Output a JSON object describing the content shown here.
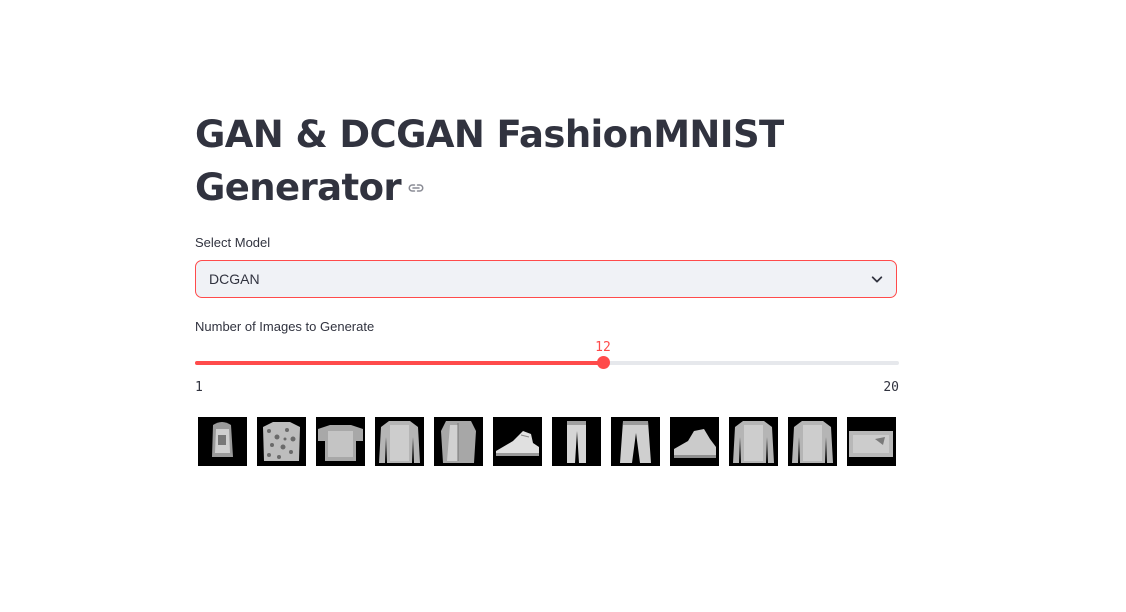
{
  "page": {
    "title_line1": "GAN & DCGAN FashionMNIST",
    "title_line2": "Generator",
    "link_icon": "link-icon"
  },
  "model_select": {
    "label": "Select Model",
    "value": "DCGAN",
    "icon": "chevron-down-icon"
  },
  "slider": {
    "label": "Number of Images to Generate",
    "value": "12",
    "min": "1",
    "max": "20",
    "accent_color": "#ff4b4b"
  },
  "gallery": {
    "images": [
      {
        "name": "generated-image",
        "kind": "bag"
      },
      {
        "name": "generated-image",
        "kind": "patterned-shirt"
      },
      {
        "name": "generated-image",
        "kind": "top"
      },
      {
        "name": "generated-image",
        "kind": "pullover"
      },
      {
        "name": "generated-image",
        "kind": "coat"
      },
      {
        "name": "generated-image",
        "kind": "sneaker"
      },
      {
        "name": "generated-image",
        "kind": "trouser"
      },
      {
        "name": "generated-image",
        "kind": "trouser-wide"
      },
      {
        "name": "generated-image",
        "kind": "ankle-boot"
      },
      {
        "name": "generated-image",
        "kind": "pullover"
      },
      {
        "name": "generated-image",
        "kind": "pullover"
      },
      {
        "name": "generated-image",
        "kind": "bag-flat"
      }
    ]
  }
}
